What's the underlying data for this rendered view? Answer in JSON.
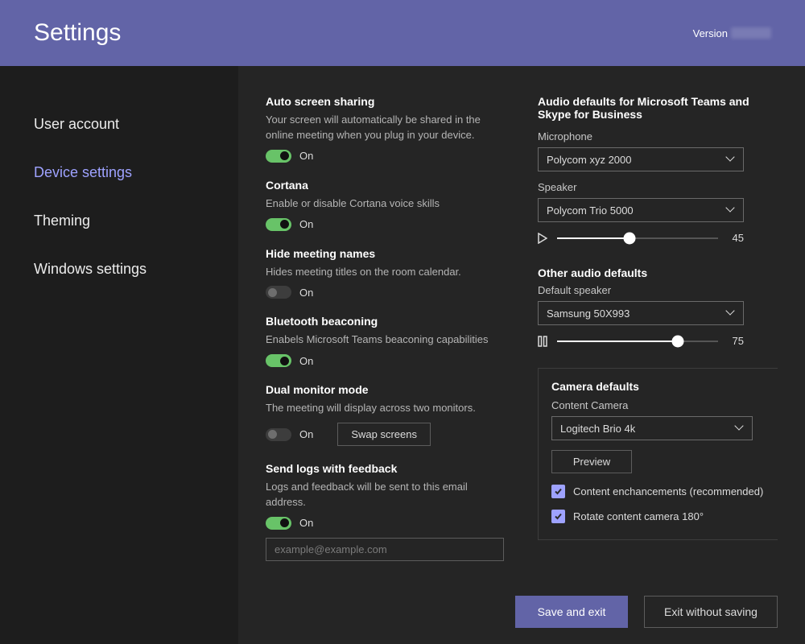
{
  "header": {
    "title": "Settings",
    "version_label": "Version"
  },
  "sidebar": {
    "items": [
      {
        "label": "User account"
      },
      {
        "label": "Device settings"
      },
      {
        "label": "Theming"
      },
      {
        "label": "Windows settings"
      }
    ],
    "active_index": 1
  },
  "left": {
    "auto_share": {
      "title": "Auto screen sharing",
      "desc": "Your screen will automatically be shared in the online meeting when you plug in your device.",
      "state_label": "On"
    },
    "cortana": {
      "title": "Cortana",
      "desc": "Enable or disable Cortana voice skills",
      "state_label": "On"
    },
    "hide_names": {
      "title": "Hide meeting names",
      "desc": "Hides meeting titles on the room calendar.",
      "state_label": "On"
    },
    "bt_beacon": {
      "title": "Bluetooth beaconing",
      "desc": "Enabels Microsoft Teams beaconing capabilities",
      "state_label": "On"
    },
    "dual_monitor": {
      "title": "Dual monitor mode",
      "desc": "The meeting will display across two monitors.",
      "state_label": "On",
      "swap_button": "Swap screens"
    },
    "logs": {
      "title": "Send logs with feedback",
      "desc": "Logs and feedback will be sent to this email address.",
      "state_label": "On",
      "email_placeholder": "example@example.com"
    }
  },
  "right": {
    "audio": {
      "title": "Audio defaults for Microsoft Teams and Skype for Business",
      "mic_label": "Microphone",
      "mic_value": "Polycom xyz 2000",
      "speaker_label": "Speaker",
      "speaker_value": "Polycom Trio 5000",
      "speaker_volume": 45
    },
    "other": {
      "title": "Other audio defaults",
      "default_sp_label": "Default speaker",
      "default_sp_value": "Samsung 50X993",
      "default_sp_volume": 75
    },
    "camera": {
      "title": "Camera defaults",
      "content_cam_label": "Content Camera",
      "content_cam_value": "Logitech Brio 4k",
      "preview_btn": "Preview",
      "enhance_label": "Content enchancements (recommended)",
      "rotate_label": "Rotate content camera 180°"
    }
  },
  "footer": {
    "save": "Save and exit",
    "exit": "Exit without saving"
  }
}
